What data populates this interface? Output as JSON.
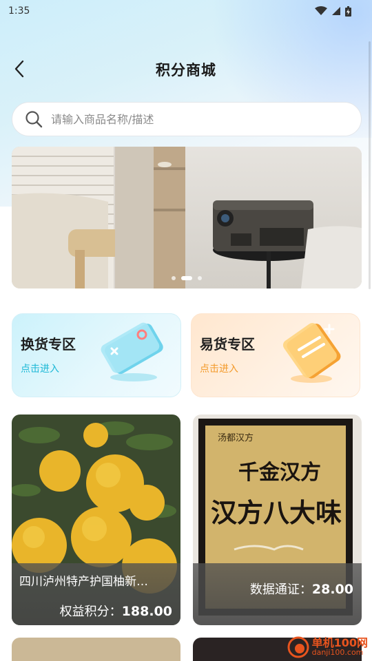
{
  "status_bar": {
    "time": "1:35"
  },
  "header": {
    "title": "积分商城"
  },
  "search": {
    "placeholder": "请输入商品名称/描述"
  },
  "banner": {
    "slide_count": 3,
    "active_index": 1
  },
  "zones": [
    {
      "title": "换货专区",
      "subtitle": "点击进入",
      "accent": "#1cb8d6"
    },
    {
      "title": "易货专区",
      "subtitle": "点击进入",
      "accent": "#f39a2a"
    }
  ],
  "products": [
    {
      "name": "四川泸州特产护国柚新…",
      "price_label": "权益积分：",
      "price": "188.00"
    },
    {
      "name": "",
      "price_label": "数据通证：",
      "price": "28.00",
      "image_text": {
        "brand": "汤都汉方",
        "line1": "千金汉方",
        "line2": "汉方八大味"
      }
    }
  ],
  "watermark": {
    "main": "单机100网",
    "sub": "danji100.com"
  }
}
